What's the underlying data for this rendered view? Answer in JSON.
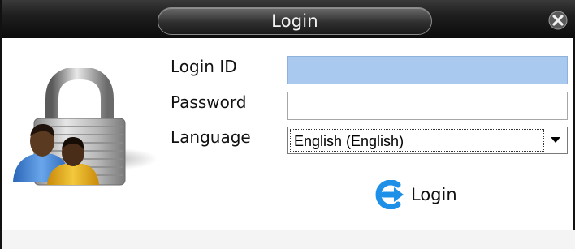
{
  "window": {
    "title": "Login"
  },
  "form": {
    "login_id_label": "Login ID",
    "login_id_value": "",
    "password_label": "Password",
    "password_value": "",
    "language_label": "Language",
    "language_selected": "English (English)"
  },
  "actions": {
    "login_label": "Login"
  },
  "icons": {
    "close": "close-icon",
    "lock_users": "lock-users-icon",
    "login": "login-arrow-icon",
    "dropdown": "dropdown-arrow-icon"
  },
  "colors": {
    "focused_field": "#a9c9ee",
    "login_icon": "#1e90e8"
  }
}
